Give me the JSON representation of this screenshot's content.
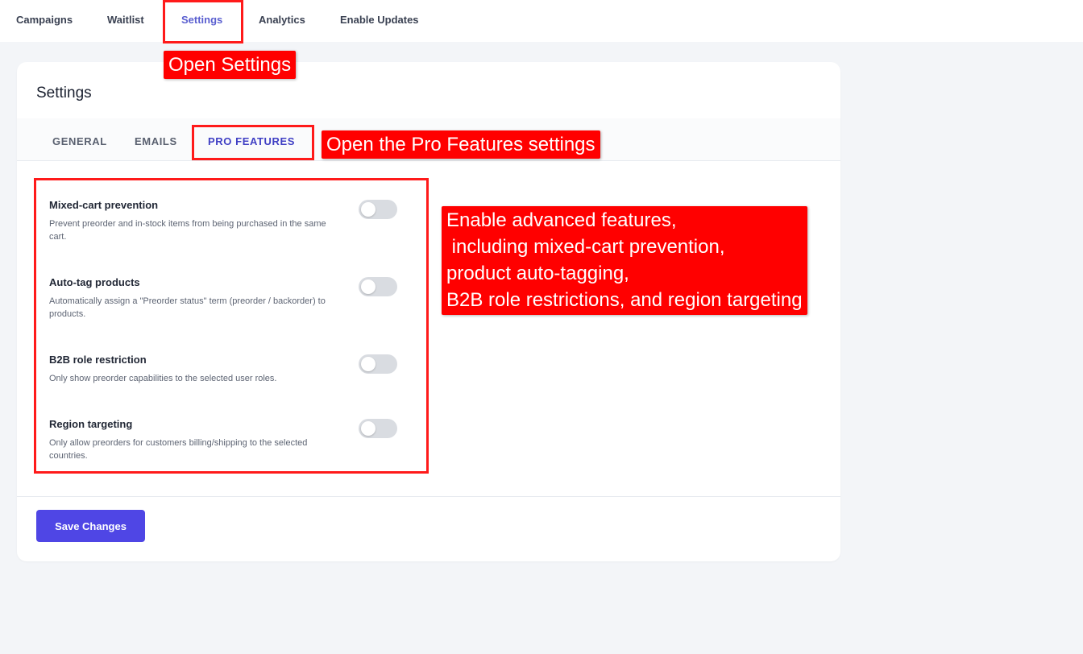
{
  "topnav": {
    "items": [
      {
        "label": "Campaigns"
      },
      {
        "label": "Waitlist"
      },
      {
        "label": "Settings"
      },
      {
        "label": "Analytics"
      },
      {
        "label": "Enable Updates"
      }
    ],
    "active": "Settings"
  },
  "annotations": {
    "open_settings": "Open Settings",
    "open_pro_features": "Open the Pro Features settings",
    "enable_advanced": "Enable advanced features,\n including mixed-cart prevention,\nproduct auto-tagging,\nB2B role restrictions, and region targeting",
    "highlight_color": "#ff0000"
  },
  "settings": {
    "title": "Settings",
    "tabs": [
      {
        "label": "GENERAL"
      },
      {
        "label": "EMAILS"
      },
      {
        "label": "PRO FEATURES"
      }
    ],
    "active_tab": "PRO FEATURES",
    "features": [
      {
        "title": "Mixed-cart prevention",
        "desc": "Prevent preorder and in-stock items from being purchased in the same cart.",
        "enabled": false
      },
      {
        "title": "Auto-tag products",
        "desc": "Automatically assign a \"Preorder status\" term (preorder / backorder) to products.",
        "enabled": false
      },
      {
        "title": "B2B role restriction",
        "desc": "Only show preorder capabilities to the selected user roles.",
        "enabled": false
      },
      {
        "title": "Region targeting",
        "desc": "Only allow preorders for customers billing/shipping to the selected countries.",
        "enabled": false
      }
    ],
    "save_label": "Save Changes"
  },
  "colors": {
    "accent": "#4f46e5",
    "active_tab": "#3f3fc4",
    "toggle_off": "#d9dce1"
  }
}
